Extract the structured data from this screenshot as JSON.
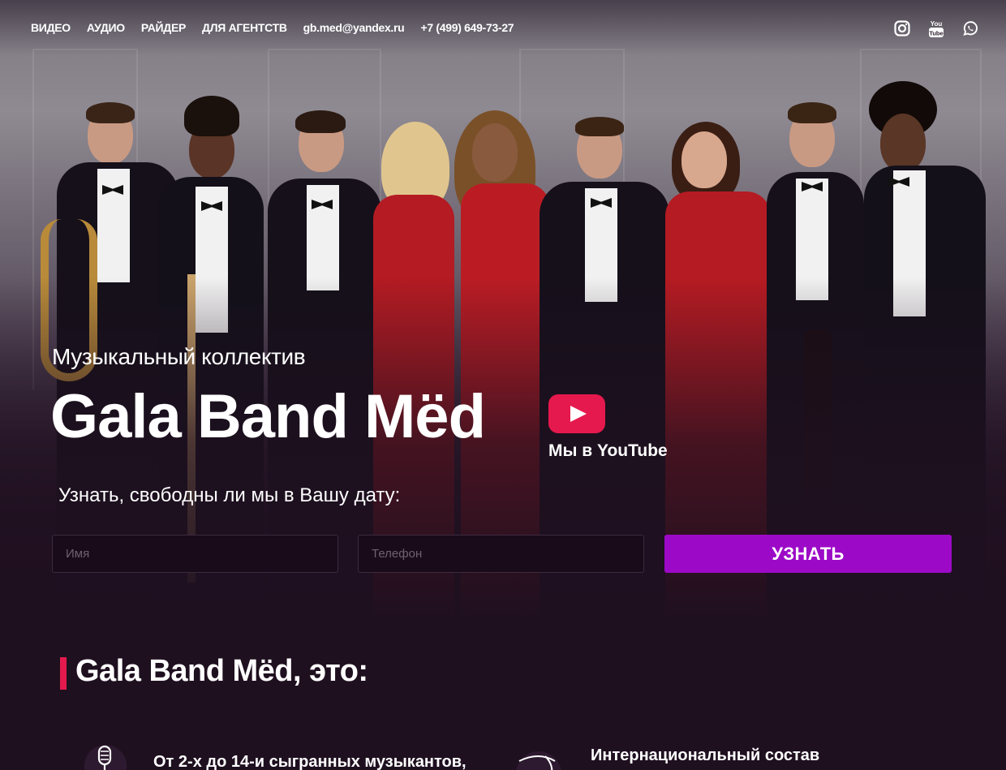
{
  "nav": {
    "links": [
      {
        "label": "ВИДЕО"
      },
      {
        "label": "АУДИО"
      },
      {
        "label": "РАЙДЕР"
      },
      {
        "label": "ДЛЯ АГЕНТСТВ"
      }
    ],
    "email": "gb.med@yandex.ru",
    "phone": "+7 (499) 649-73-27",
    "socials": [
      {
        "icon": "instagram-icon"
      },
      {
        "icon": "youtube-icon",
        "text": "You Tube"
      },
      {
        "icon": "whatsapp-icon"
      }
    ]
  },
  "hero": {
    "subtitle": "Музыкальный коллектив",
    "title": "Gala Band Mёd",
    "youtube_label": "Мы в YouTube",
    "date_question": "Узнать, свободны ли мы в Вашу дату:",
    "form": {
      "name_placeholder": "Имя",
      "phone_placeholder": "Телефон",
      "submit_label": "УЗНАТЬ"
    }
  },
  "about": {
    "title": "Gala Band Mёd, это:",
    "features": [
      {
        "icon": "microphone-icon",
        "text": "От 2-х до 14-и сыгранных музыкантов,"
      },
      {
        "icon": "globe-icon",
        "text": "Интернациональный состав"
      }
    ]
  },
  "colors": {
    "accent_pink": "#e5194d",
    "button_purple": "#9c0ac7",
    "background": "#1f1020"
  }
}
